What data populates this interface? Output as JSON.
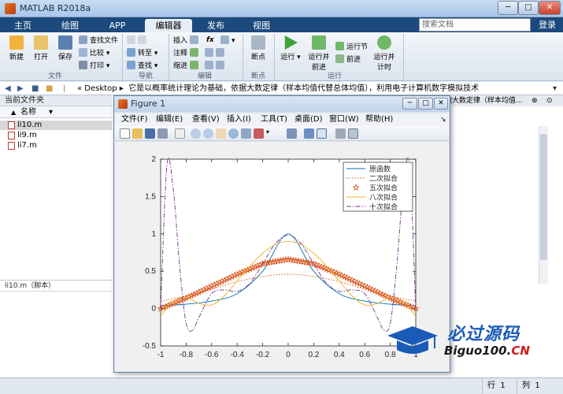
{
  "app": {
    "title": "MATLAB R2018a",
    "search_placeholder": "搜索文档",
    "login": "登录"
  },
  "tabs": [
    "主页",
    "绘图",
    "APP",
    "编辑器",
    "发布",
    "视图"
  ],
  "active_tab": 3,
  "ribbon": {
    "file": {
      "new": "新建",
      "open": "打开",
      "save": "保存",
      "find_files": "查找文件",
      "compare": "比较",
      "print": "打印",
      "group": "文件"
    },
    "nav": {
      "goto": "转至",
      "find": "查找",
      "group": "导航"
    },
    "edit": {
      "insert": "插入",
      "comment": "注释",
      "indent": "缩进",
      "fx": "fx",
      "group": "编辑"
    },
    "breakpoints": {
      "label": "断点",
      "group": "断点"
    },
    "run": {
      "run": "运行",
      "run_advance_1": "运行并",
      "run_advance_2": "前进",
      "run_section": "运行节",
      "advance": "前进",
      "run_time_1": "运行并",
      "run_time_2": "计时",
      "group": "运行"
    }
  },
  "address": {
    "crumb": "« Desktop",
    "path": "它是以概率统计理论为基础，依据大数定律（样本均值代替总体均值），利用电子计算机数字模拟技术"
  },
  "left_panel": {
    "title": "当前文件夹",
    "col_name": "名称",
    "sort": "▲",
    "files": [
      "li10.m",
      "li9.m",
      "li7.m"
    ],
    "selected": 0,
    "status": "li10.m（脚本）"
  },
  "right_panel": {
    "title": "撞大数定律（样本均值..."
  },
  "statusbar": {
    "row_label": "行",
    "row": "1",
    "col_label": "列",
    "col": "1"
  },
  "figure": {
    "title": "Figure 1",
    "menus": [
      "文件(F)",
      "编辑(E)",
      "查看(V)",
      "插入(I)",
      "工具(T)",
      "桌面(D)",
      "窗口(W)",
      "帮助(H)"
    ]
  },
  "chart_data": {
    "type": "line",
    "title": "",
    "xlabel": "",
    "ylabel": "",
    "xlim": [
      -1,
      1
    ],
    "ylim": [
      -0.5,
      2
    ],
    "xticks": [
      -1,
      -0.8,
      -0.6,
      -0.4,
      -0.2,
      0,
      0.2,
      0.4,
      0.6,
      0.8,
      1
    ],
    "yticks": [
      -0.5,
      0,
      0.5,
      1,
      1.5,
      2
    ],
    "legend_position": "top-right",
    "series": [
      {
        "name": "原函数",
        "color": "#0072bd",
        "style": "solid",
        "x": [
          -1,
          -0.8,
          -0.6,
          -0.4,
          -0.2,
          0,
          0.2,
          0.4,
          0.6,
          0.8,
          1
        ],
        "y": [
          0.038,
          0.059,
          0.1,
          0.2,
          0.5,
          1.0,
          0.5,
          0.2,
          0.1,
          0.059,
          0.038
        ]
      },
      {
        "name": "二次拟合",
        "color": "#d95319",
        "style": "dotted",
        "x": [
          -1,
          -0.8,
          -0.6,
          -0.4,
          -0.2,
          0,
          0.2,
          0.4,
          0.6,
          0.8,
          1
        ],
        "y": [
          0.1,
          0.17,
          0.26,
          0.36,
          0.43,
          0.46,
          0.43,
          0.36,
          0.26,
          0.17,
          0.1
        ]
      },
      {
        "name": "五次拟合",
        "color": "#d95319",
        "style": "pentagram",
        "x": [
          -1,
          -0.8,
          -0.6,
          -0.4,
          -0.2,
          0,
          0.2,
          0.4,
          0.6,
          0.8,
          1
        ],
        "y": [
          0.0,
          0.14,
          0.3,
          0.46,
          0.6,
          0.66,
          0.6,
          0.46,
          0.3,
          0.14,
          0.0
        ]
      },
      {
        "name": "八次拟合",
        "color": "#edb120",
        "style": "solid",
        "x": [
          -1,
          -0.9,
          -0.8,
          -0.7,
          -0.6,
          -0.5,
          -0.4,
          -0.3,
          -0.2,
          -0.1,
          0,
          0.1,
          0.2,
          0.3,
          0.4,
          0.5,
          0.6,
          0.7,
          0.8,
          0.9,
          1
        ],
        "y": [
          -0.1,
          0.1,
          0.15,
          0.07,
          0.05,
          0.17,
          0.37,
          0.57,
          0.74,
          0.86,
          0.9,
          0.86,
          0.74,
          0.57,
          0.37,
          0.17,
          0.05,
          0.07,
          0.15,
          0.1,
          -0.1
        ]
      },
      {
        "name": "十次拟合",
        "color": "#7e2f8e",
        "style": "dashdot",
        "x": [
          -1,
          -0.95,
          -0.9,
          -0.85,
          -0.8,
          -0.75,
          -0.7,
          -0.6,
          -0.5,
          -0.4,
          -0.3,
          -0.2,
          -0.1,
          0,
          0.1,
          0.2,
          0.3,
          0.4,
          0.5,
          0.6,
          0.7,
          0.75,
          0.8,
          0.85,
          0.9,
          0.95,
          1
        ],
        "y": [
          0.0,
          1.93,
          1.58,
          0.55,
          -0.2,
          -0.29,
          -0.12,
          0.2,
          0.25,
          0.23,
          0.34,
          0.6,
          0.87,
          0.98,
          0.87,
          0.6,
          0.34,
          0.23,
          0.25,
          0.2,
          -0.12,
          -0.29,
          -0.2,
          0.55,
          1.58,
          1.93,
          0.0
        ]
      }
    ]
  },
  "watermark": {
    "line1": "必过源码",
    "line2_main": "Biguo100.",
    "line2_suffix": "CN"
  }
}
